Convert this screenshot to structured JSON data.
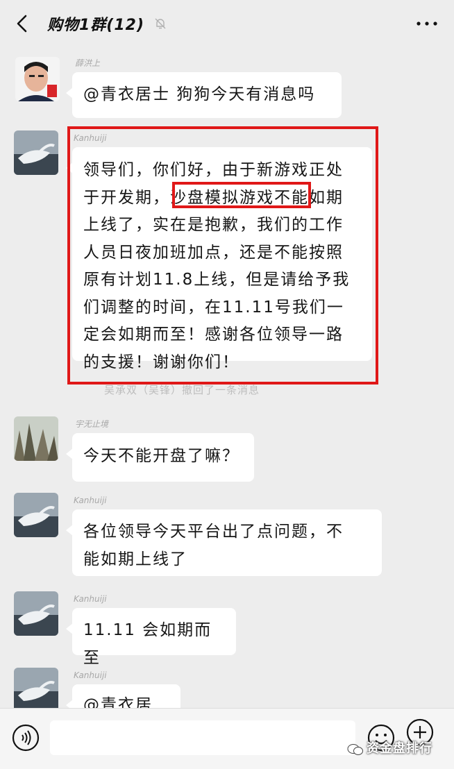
{
  "header": {
    "title": "购物1群(12)"
  },
  "messages": [
    {
      "sender": "薛洪上",
      "text": "@青衣居士 狗狗今天有消息吗",
      "avatar": "man-photo-avatar"
    },
    {
      "sender": "Kanhuiji",
      "lines": [
        "领导们，你们好，由于新游戏正处",
        "于开发期，",
        "沙盘模拟游戏不",
        "能如期",
        "上线了，实在是抱歉，我们的工作",
        "人员日夜加班加点，还是不能按照",
        "原有计划11.8上线，但是请给予我",
        "们调整的时间，在11.11号我们一",
        "定会如期而至！感谢各位领导一路",
        "的支援！谢谢你们！"
      ],
      "avatar": "swan-avatar"
    },
    {
      "sender": "宇无止境",
      "text": "今天不能开盘了嘛？",
      "avatar": "mountain-avatar"
    },
    {
      "sender": "Kanhuiji",
      "lines": [
        "各位领导今天平台出了点问题，不",
        "能如期上线了"
      ],
      "avatar": "swan-avatar"
    },
    {
      "sender": "Kanhuiji",
      "text": "11.11 会如期而至",
      "avatar": "swan-avatar"
    },
    {
      "sender": "Kanhuiji",
      "text": "@青衣居士",
      "avatar": "swan-avatar"
    }
  ],
  "recall_note": "吴承双（吴锋）撤回了一条消息",
  "watermark": "资金盘排行",
  "colors": {
    "highlight_border": "#e01818",
    "bubble": "#ffffff",
    "background": "#ededed"
  }
}
